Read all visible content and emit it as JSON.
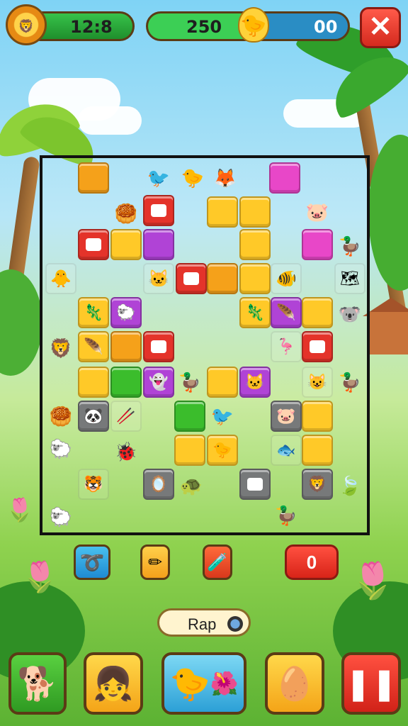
{
  "hud": {
    "timer": "12:8",
    "score": "250",
    "score_right": "00"
  },
  "board": {
    "cells": [
      {
        "type": "block",
        "color": "orange"
      },
      {
        "type": "critter",
        "icon": "bird-icon",
        "glyph": "🐦"
      },
      {
        "type": "critter",
        "icon": "chick-icon",
        "glyph": "🐤"
      },
      {
        "type": "critter",
        "icon": "fox-icon",
        "glyph": "🦊"
      },
      {
        "type": "block",
        "color": "pink"
      },
      {
        "type": "critter",
        "icon": "squash-icon",
        "glyph": "🥮"
      },
      {
        "type": "block",
        "color": "red",
        "face": true
      },
      {
        "type": "block",
        "color": "yellow"
      },
      {
        "type": "block",
        "color": "yellow"
      },
      {
        "type": "critter",
        "icon": "pig-icon",
        "glyph": "🐷"
      },
      {
        "type": "block",
        "color": "red",
        "face": true
      },
      {
        "type": "block",
        "color": "yellow"
      },
      {
        "type": "block",
        "color": "purple"
      },
      {
        "type": "block",
        "color": "yellow"
      },
      {
        "type": "block",
        "color": "pink"
      },
      {
        "type": "critter",
        "icon": "duck-icon",
        "glyph": "🦆"
      }
    ],
    "empty": ""
  },
  "tools": {
    "swap_icon": "swap-icon",
    "pencil_icon": "pencil-icon",
    "potion_icon": "potion-icon",
    "score_value": "0"
  },
  "rap_button": {
    "label": "Rap"
  },
  "bottom_bar": {
    "items": [
      {
        "name": "animal-tab",
        "glyph": "🐕",
        "color": "#3fbd33"
      },
      {
        "name": "avatar-tab",
        "glyph": "👧",
        "color": "#ffc928"
      },
      {
        "name": "garden-tab",
        "glyph": "🐤",
        "color": "#5fc4e8"
      },
      {
        "name": "egg-tab",
        "glyph": "🥚",
        "color": "#ffc928"
      },
      {
        "name": "pause-tab",
        "glyph": "⏸",
        "color": "#e4332a"
      }
    ]
  },
  "colors": {
    "orange": "#f5a11a",
    "yellow": "#ffc928",
    "pink": "#e847c8",
    "purple": "#b043d6",
    "green": "#3bbd2c",
    "red": "#e4332a",
    "gray": "#77797a"
  }
}
